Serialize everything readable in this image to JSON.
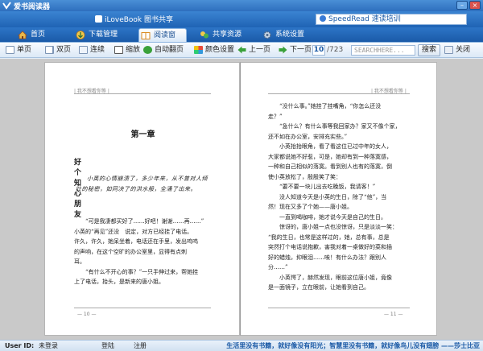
{
  "window": {
    "title": "爱书阅读器"
  },
  "strip": {
    "ilovebook": "iLoveBook 图书共享",
    "speedread": "SpeedRead 速读培训"
  },
  "tabs": [
    {
      "label": "首页",
      "icon": "home-icon"
    },
    {
      "label": "下载管理",
      "icon": "download-icon"
    },
    {
      "label": "阅读窗",
      "icon": "book-icon"
    },
    {
      "label": "共享资源",
      "icon": "share-icon"
    },
    {
      "label": "系统设置",
      "icon": "settings-icon"
    }
  ],
  "toolbar": {
    "single": "单页",
    "double": "双页",
    "continuous": "连续",
    "zoom": "缩放",
    "autoflip": "自动翻页",
    "color": "颜色设置",
    "prev": "上一页",
    "next": "下一页",
    "page_current": "10",
    "page_total": "/723",
    "search_placeholder": "SEARCHHERE...",
    "search": "搜索",
    "close": "关闭"
  },
  "left_page": {
    "header": "| 我不想看你等 |",
    "chapter": "第一章",
    "section": "好个知心朋友",
    "poem": [
      "小英的心情崩溃了，多少年来，从不曾对人倾",
      "吐的秘密，如同决了的洪水般，全涌了出来。"
    ],
    "para": [
      "“可是我凄都买好了……好吧！谢谢……再……”",
      "小英的“再见”还没　说定，对方已经挂了电话。",
      "许久，许久，她呆坐着，电话还在手里，发出呜呜",
      "的声响，在这个空旷的办公室里，显得有点刺",
      "耳。",
      "“有什么不开心的事？”一只手伸过来，帮她挂",
      "上了电话，抬头，是新来的唐小姐。"
    ],
    "footer": "— 10 —"
  },
  "right_page": {
    "header": "| 我不想看你等 |",
    "para": [
      "“没什么事。”她挂了挂嘴角，“你怎么还没",
      "走？”",
      "“急什么？有什么事等我回家办？家又不像个家，",
      "还不如在办公室，安排充实些。”",
      "小英抬抬眼角，看了看这位已过中年的女人，",
      "大家都说她不好惹，可是，她却有到一种落寞感，",
      "一种和自己相似的落寞。看到别人也有的落寞，倒",
      "使小英放松了，殷殷笑了笑：",
      "“要不要一块儿出去吃晚饭，我请客！”",
      "没人知道今天是小英的生日，除了“他”，当",
      "然！现在又多了个她——唐小姐。",
      "一直到喝咖啡，她才说今天是自己的生日。",
      "惊讶的，唐小姐一点也没惊讶，只是淡淡一笑：",
      "“我的生日，也常是这样过的，她，总有事，总是",
      "突然打个电话说抱歉，害我对着一桌做好的菜和插",
      "好的蜡烛，抑眼泪……唉！有什么办法？跟别人",
      "分……”",
      "小英愕了，赫然发现，眼前这位唐小姐，竟像",
      "是一面镜子，立在眼前，让她看到自己。"
    ],
    "footer": "— 11 —"
  },
  "status": {
    "userid_label": "User ID:",
    "userid_value": "未登录",
    "login": "登陆",
    "register": "注册",
    "slogan": "生活里没有书籍，就好像没有阳光；智慧里没有书籍，就好像鸟儿没有翅膀 ——莎士比亚"
  }
}
